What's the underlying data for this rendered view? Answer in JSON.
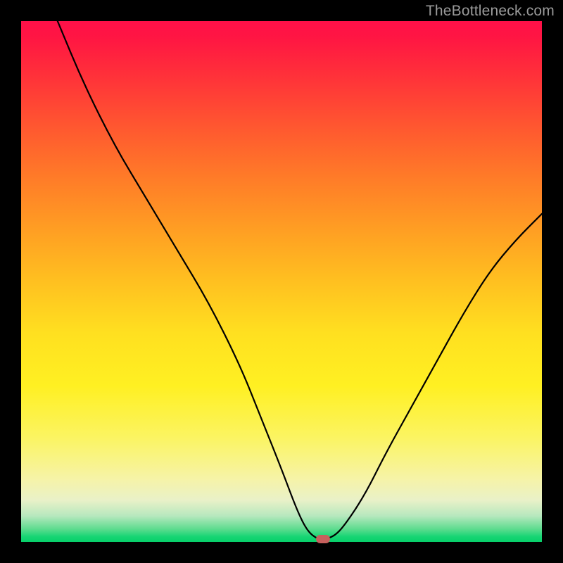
{
  "watermark": "TheBottleneck.com",
  "chart_data": {
    "type": "line",
    "title": "",
    "xlabel": "",
    "ylabel": "",
    "xlim": [
      0,
      100
    ],
    "ylim": [
      0,
      100
    ],
    "series": [
      {
        "name": "curve",
        "x": [
          7,
          12,
          18,
          24,
          30,
          36,
          42,
          46,
          50,
          53,
          55,
          57,
          58,
          60,
          62,
          66,
          70,
          75,
          80,
          85,
          90,
          95,
          100
        ],
        "y": [
          100,
          88,
          76,
          66,
          56,
          46,
          34,
          24,
          14,
          6,
          2,
          0.5,
          0.5,
          1,
          3,
          9,
          17,
          26,
          35,
          44,
          52,
          58,
          63
        ]
      }
    ],
    "marker": {
      "x": 58,
      "y": 0.5,
      "color": "#c6605d"
    },
    "background_gradient": {
      "top": "#ff1049",
      "mid": "#ffe020",
      "bottom": "#07d06a"
    }
  }
}
